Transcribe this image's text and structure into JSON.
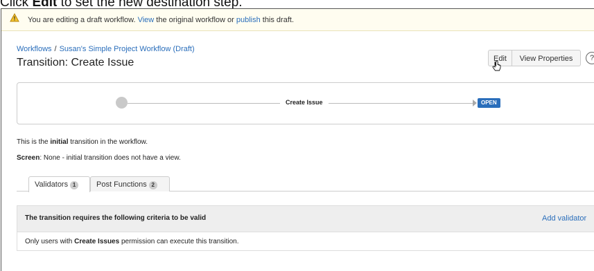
{
  "caption": {
    "prefix": "Click ",
    "bold": "Edit",
    "suffix": " to set the new destination step."
  },
  "banner": {
    "text_a": "You are editing a draft workflow. ",
    "link_view": "View",
    "text_b": " the original workflow or ",
    "link_publish": "publish",
    "text_c": " this draft.",
    "icon": "warning-icon"
  },
  "breadcrumb": {
    "root": "Workflows",
    "sep": "/",
    "current": "Susan's Simple Project Workflow (Draft)"
  },
  "page_title": "Transition: Create Issue",
  "buttons": {
    "edit": "Edit",
    "view_properties": "View Properties",
    "help": "?"
  },
  "diagram": {
    "transition": "Create Issue",
    "status": "OPEN"
  },
  "info": {
    "line1_a": "This is the ",
    "line1_b": "initial",
    "line1_c": " transition in the workflow.",
    "screen_label": "Screen",
    "screen_value": ": None - initial transition does not have a view."
  },
  "tabs": [
    {
      "label": "Validators",
      "count": "1"
    },
    {
      "label": "Post Functions",
      "count": "2"
    }
  ],
  "validators_panel": {
    "header": "The transition requires the following criteria to be valid",
    "add_link": "Add validator",
    "row_a": "Only users with ",
    "row_b": "Create Issues",
    "row_c": " permission can execute this transition."
  },
  "colors": {
    "link": "#2a6ebb",
    "status_open": "#2a6ebb",
    "banner_bg": "#fffdf0"
  }
}
